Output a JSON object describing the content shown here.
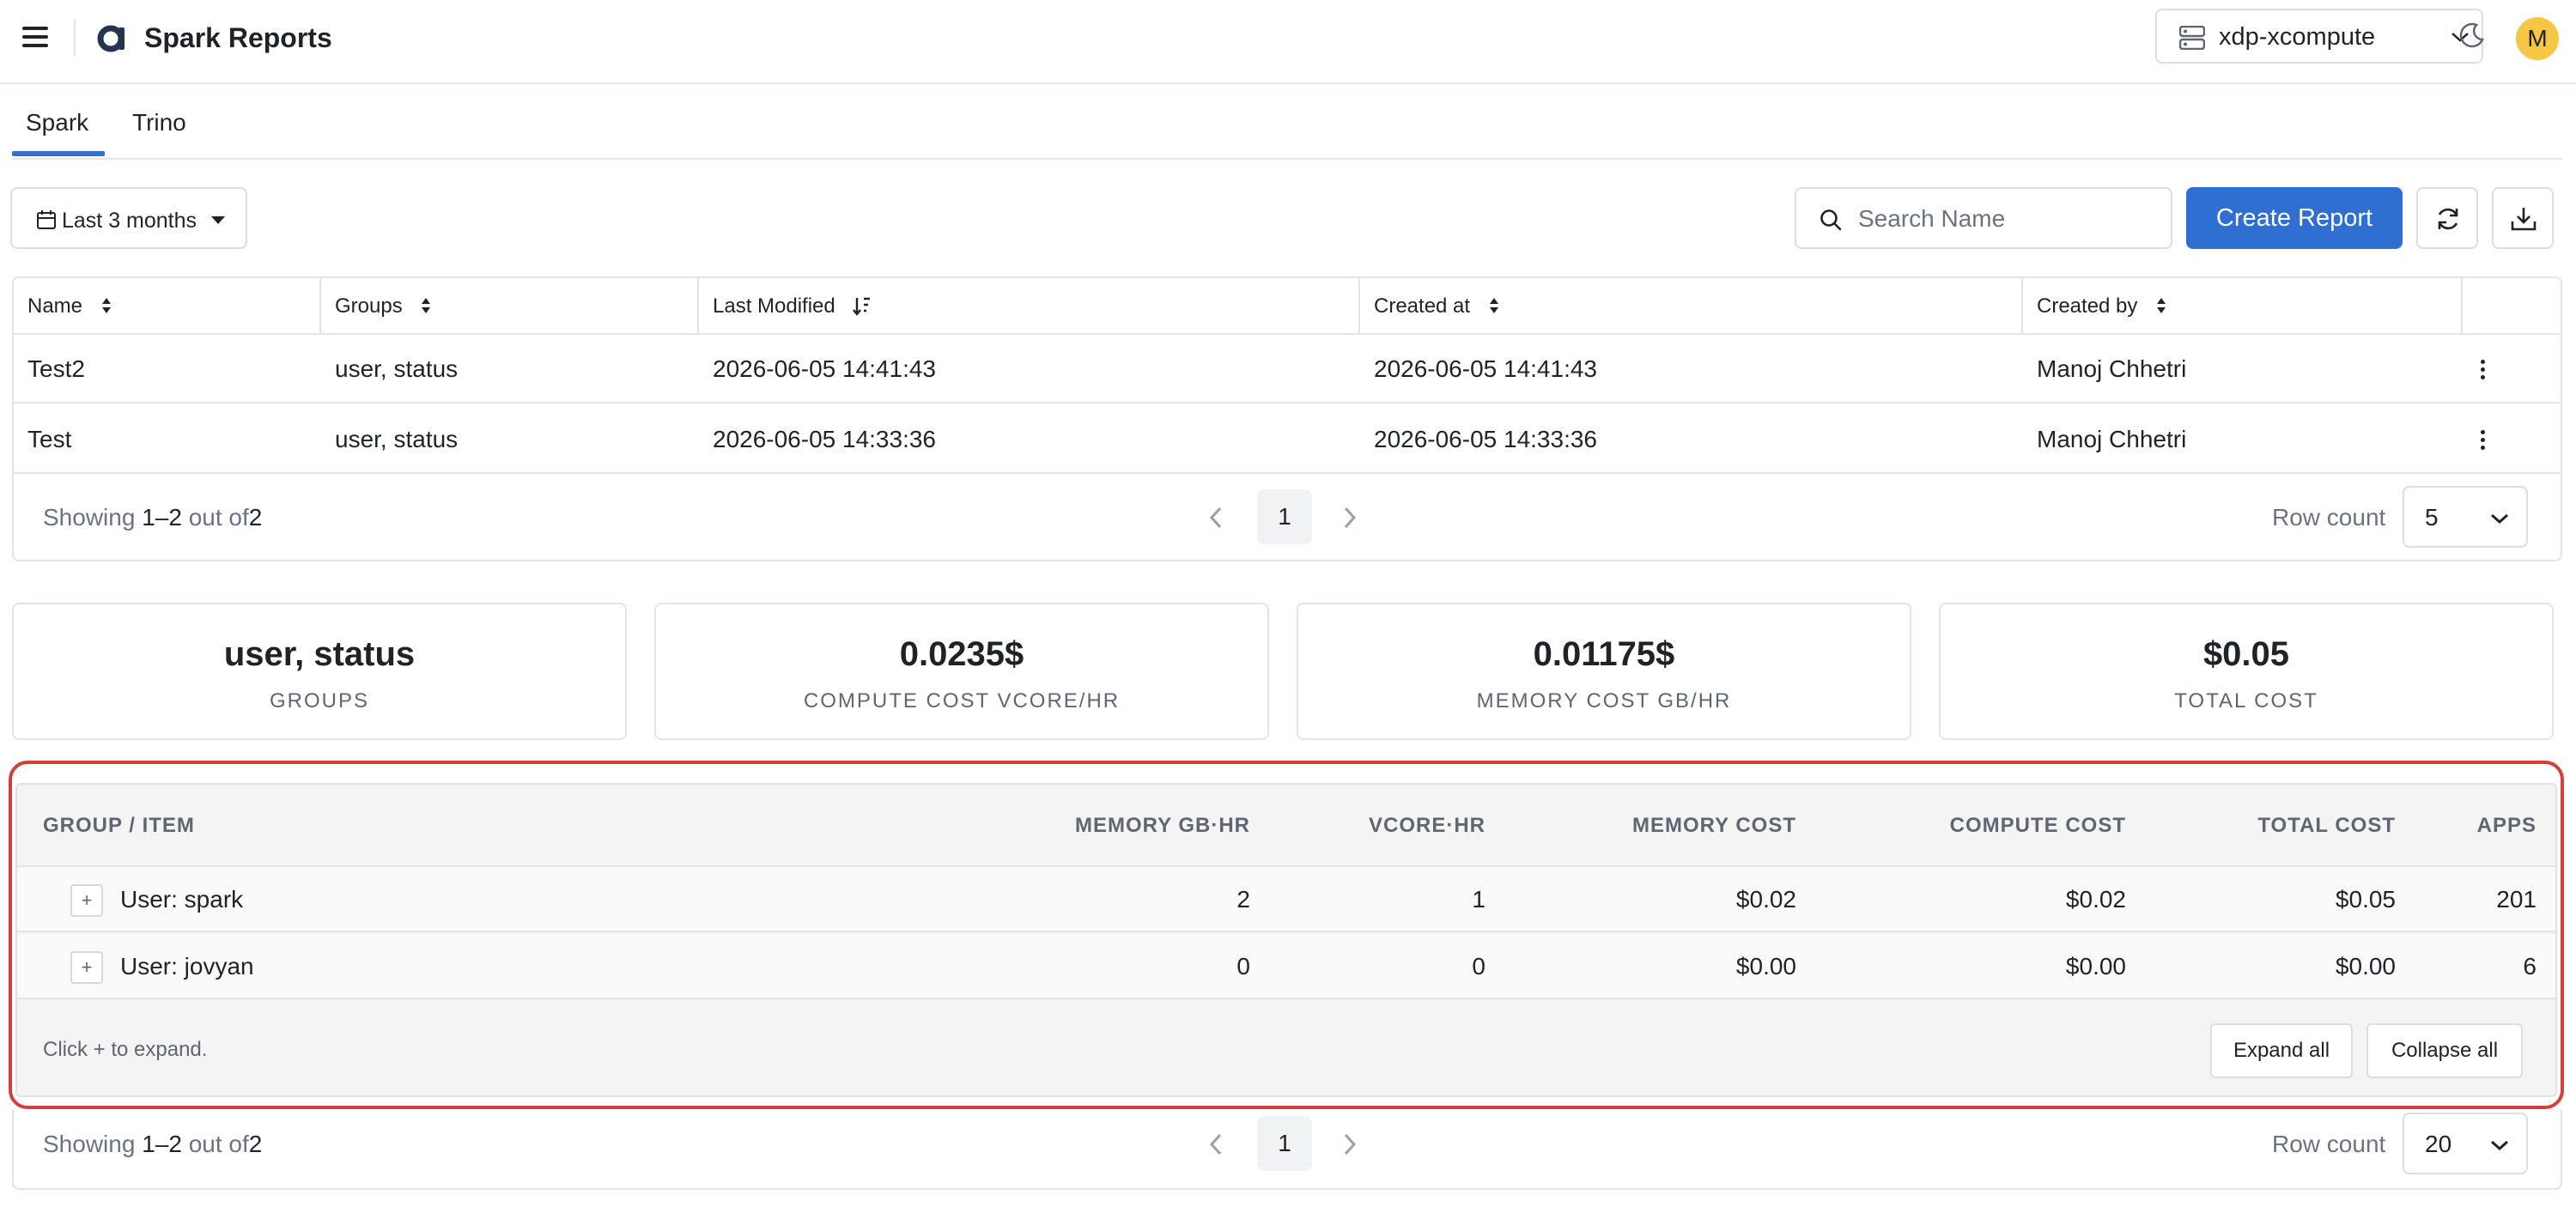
{
  "header": {
    "app_title": "Spark Reports",
    "cluster": "xdp-xcompute",
    "avatar_initial": "M"
  },
  "tabs": [
    {
      "label": "Spark",
      "active": true
    },
    {
      "label": "Trino",
      "active": false
    }
  ],
  "toolbar": {
    "date_range": "Last 3 months",
    "search_placeholder": "Search Name",
    "create_label": "Create Report"
  },
  "reports_table": {
    "columns": [
      "Name",
      "Groups",
      "Last Modified",
      "Created at",
      "Created by"
    ],
    "rows": [
      {
        "name": "Test2",
        "groups": "user, status",
        "last_modified": "2026-06-05 14:41:43",
        "created_at": "2026-06-05 14:41:43",
        "created_by": "Manoj Chhetri"
      },
      {
        "name": "Test",
        "groups": "user, status",
        "last_modified": "2026-06-05 14:33:36",
        "created_at": "2026-06-05 14:33:36",
        "created_by": "Manoj Chhetri"
      }
    ],
    "footer": {
      "showing_prefix": "Showing",
      "range": "1–2",
      "out_of": "out of",
      "total": "2",
      "page": "1",
      "row_count_label": "Row count",
      "row_count": "5"
    }
  },
  "summary_cards": [
    {
      "value": "user, status",
      "label": "GROUPS"
    },
    {
      "value": "0.0235$",
      "label": "COMPUTE COST VCORE/HR"
    },
    {
      "value": "0.01175$",
      "label": "MEMORY COST GB/HR"
    },
    {
      "value": "$0.05",
      "label": "TOTAL COST"
    }
  ],
  "group_table": {
    "columns": [
      "GROUP / ITEM",
      "MEMORY GB·HR",
      "VCORE·HR",
      "MEMORY COST",
      "COMPUTE COST",
      "TOTAL COST",
      "APPS"
    ],
    "rows": [
      {
        "item": "User: spark",
        "memory_gb_hr": "2",
        "vcore_hr": "1",
        "memory_cost": "$0.02",
        "compute_cost": "$0.02",
        "total_cost": "$0.05",
        "apps": "201"
      },
      {
        "item": "User: jovyan",
        "memory_gb_hr": "0",
        "vcore_hr": "0",
        "memory_cost": "$0.00",
        "compute_cost": "$0.00",
        "total_cost": "$0.00",
        "apps": "6"
      }
    ],
    "expand_symbol": "+",
    "hint": "Click + to expand.",
    "expand_all_label": "Expand all",
    "collapse_all_label": "Collapse all",
    "footer": {
      "showing_prefix": "Showing",
      "range": "1–2",
      "out_of": "out of",
      "total": "2",
      "page": "1",
      "row_count_label": "Row count",
      "row_count": "20"
    }
  },
  "colors": {
    "accent": "#2f6fd1",
    "highlight_border": "#d2403a",
    "avatar": "#f6c744"
  },
  "icons": [
    "hamburger-icon",
    "brand-logo-icon",
    "server-icon",
    "chevron-down-icon",
    "moon-icon",
    "calendar-icon",
    "search-icon",
    "refresh-icon",
    "download-icon",
    "sort-icon",
    "kebab-icon",
    "chevron-left-icon",
    "chevron-right-icon"
  ]
}
